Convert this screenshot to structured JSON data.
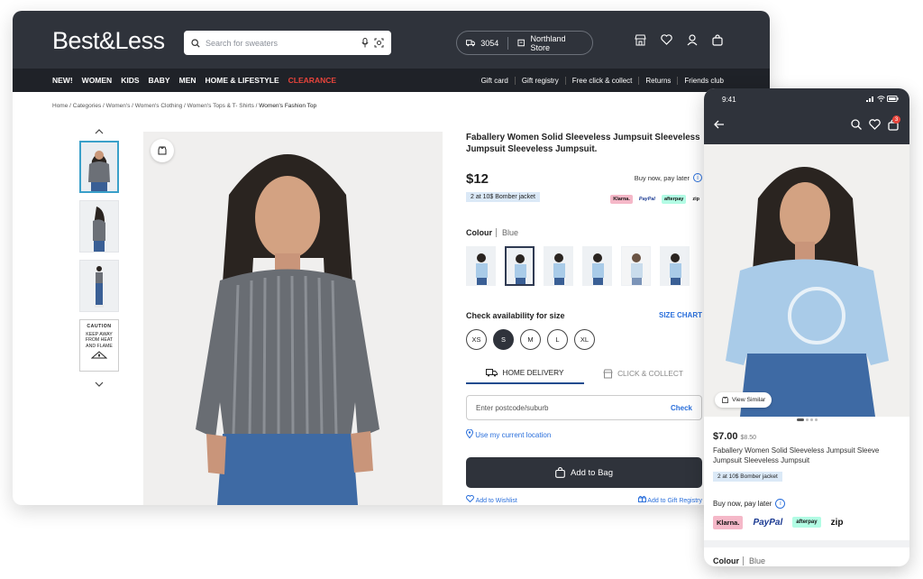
{
  "colors": {
    "header_bg": "#2f333b",
    "nav_bg": "#1f2228",
    "accent_blue": "#2a6fdb",
    "clearance_red": "#e8443b"
  },
  "header": {
    "logo": "Best&Less",
    "search_placeholder": "Search for sweaters",
    "postcode": "3054",
    "store": "Northland Store",
    "icons": [
      "store-icon",
      "heart-icon",
      "user-icon",
      "bag-icon"
    ]
  },
  "nav": {
    "items": [
      "NEW!",
      "WOMEN",
      "KIDS",
      "BABY",
      "MEN",
      "HOME & LIFESTYLE",
      "CLEARANCE"
    ],
    "right": [
      "Gift card",
      "Gift registry",
      "Free click & collect",
      "Returns",
      "Friends club"
    ]
  },
  "breadcrumb": {
    "trail": "Home / Categories / Women's / Women's Clothing / Women's Tops & T- Shirts / ",
    "current": "Women's Fashion Top"
  },
  "caution": {
    "title": "CAUTION",
    "text": "KEEP AWAY FROM HEAT AND FLAME"
  },
  "product": {
    "title": "Faballery Women Solid Sleeveless Jumpsuit Sleeveless Jumpsuit Sleeveless Jumpsuit.",
    "price": "$12",
    "bnpl_label": "Buy now, pay later",
    "promo": "2 at 10$ Bomber jacket",
    "pay_logos": [
      "Klarna.",
      "PayPal",
      "afterpay",
      "zip"
    ],
    "colour_label": "Colour",
    "colour_value": "Blue",
    "size_label": "Check availability for size",
    "size_chart": "SIZE CHART",
    "sizes": [
      "XS",
      "S",
      "M",
      "L",
      "XL"
    ],
    "selected_size": "S",
    "tab_delivery": "HOME DELIVERY",
    "tab_collect": "CLICK & COLLECT",
    "postcode_placeholder": "Enter postcode/suburb",
    "check": "Check",
    "use_location": "Use my current location",
    "add_to_bag": "Add to Bag",
    "add_wishlist": "Add to Wishlist",
    "add_registry": "Add to Gift Registry"
  },
  "mobile": {
    "time": "9:41",
    "bag_count": "3",
    "view_similar": "View Similar",
    "price": "$7.00",
    "was_price": "$8.50",
    "title": "Faballery Women Solid Sleeveless Jumpsuit Sleeve Jumpsuit Sleeveless Jumpsuit",
    "promo": "2 at 10$ Bomber jacket",
    "bnpl_label": "Buy now, pay later",
    "pay_logos": [
      "Klarna.",
      "PayPal",
      "afterpay",
      "zip"
    ],
    "colour_label": "Colour",
    "colour_value": "Blue"
  }
}
